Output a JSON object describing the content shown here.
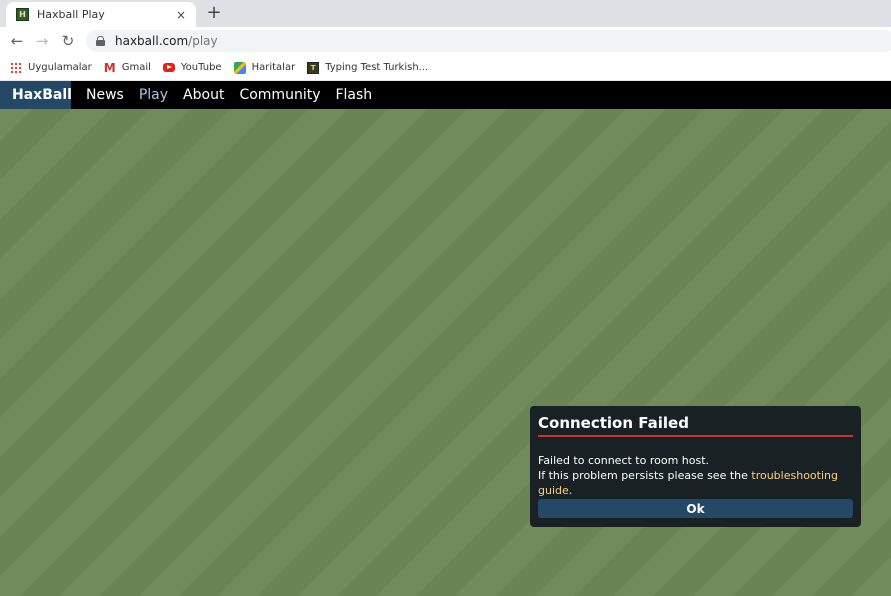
{
  "browser": {
    "tab_title": "Haxball Play",
    "tab_close": "×",
    "new_tab": "+",
    "url_host": "haxball.com",
    "url_path": "/play"
  },
  "bookmarks": [
    {
      "label": "Uygulamalar",
      "icon": "apps-grid-icon"
    },
    {
      "label": "Gmail",
      "icon": "gmail-icon"
    },
    {
      "label": "YouTube",
      "icon": "youtube-icon"
    },
    {
      "label": "Haritalar",
      "icon": "maps-icon"
    },
    {
      "label": "Typing Test Turkish...",
      "icon": "typing-test-icon"
    }
  ],
  "site_nav": {
    "logo": "HaxBall",
    "links": [
      "News",
      "Play",
      "About",
      "Community",
      "Flash"
    ],
    "active": "Play"
  },
  "dialog": {
    "title": "Connection Failed",
    "line1": "Failed to connect to room host.",
    "line2_prefix": "If this problem persists please see the ",
    "link_text": "troubleshooting guide",
    "line2_suffix": ".",
    "ok_label": "Ok"
  },
  "colors": {
    "nav_bg": "#000000",
    "logo_bg": "#244967",
    "field_stripe_a": "#718c5a",
    "field_stripe_b": "#6a8553",
    "dialog_bg": "#1a2125",
    "title_underline": "#c13535",
    "link": "#fbd17c"
  }
}
